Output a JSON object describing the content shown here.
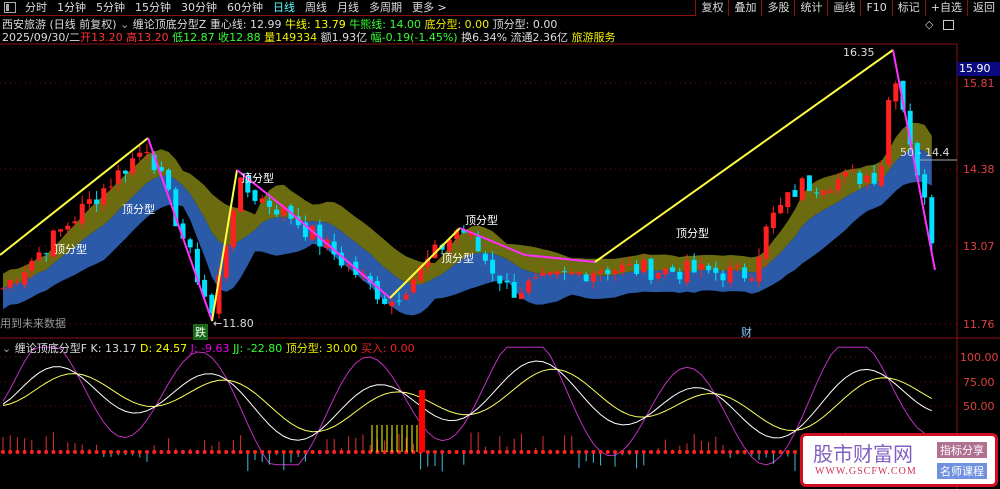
{
  "toolbar": {
    "periods": [
      "分时",
      "1分钟",
      "5分钟",
      "15分钟",
      "30分钟",
      "60分钟",
      "日线",
      "周线",
      "月线",
      "多周期",
      "更多 >"
    ],
    "active": "日线",
    "buttons": [
      "复权",
      "叠加",
      "多股",
      "统计",
      "画线",
      "F10",
      "标记",
      "+自选",
      "返回"
    ]
  },
  "header": {
    "stock": "西安旅游 (日线 前复权)",
    "indicator": "缠论顶底分型Z",
    "center_line": "重心线: 12.99",
    "bull_line": "牛线: 13.79",
    "bullbear_line": "牛熊线: 14.00",
    "bottom_fractal": "底分型: 0.00",
    "top_fractal": "顶分型: 0.00"
  },
  "quote": {
    "date": "2025/09/30/二",
    "open": "开13.20",
    "high": "高13.20",
    "low": "低12.87",
    "close": "收12.88",
    "volume": "量149334",
    "amount": "额1.93亿",
    "change": "幅-0.19(-1.45%)",
    "turnover": "换6.34%",
    "float": "流通2.36亿",
    "sector": "旅游服务"
  },
  "price_axis": {
    "current": "15.90",
    "ticks": [
      "15.81",
      "14.38",
      "13.07",
      "11.76"
    ]
  },
  "annotations": {
    "fractal_label": "顶分型",
    "high": "16.35",
    "low": "←11.80",
    "drop": "跌",
    "cai": "财",
    "future_warning": "用到未来数据",
    "cursor_price": "50 - 14.4"
  },
  "indicator": {
    "name": "缠论顶底分型F",
    "k": "K: 13.17",
    "d": "D: 24.57",
    "j": "J: -9.63",
    "jj": "JJ: -22.80",
    "top": "顶分型: 30.00",
    "buy": "买入: 0.00",
    "ticks": [
      "100.00",
      "75.00",
      "50.00"
    ]
  },
  "ad": {
    "title": "股市财富网",
    "url": "WWW.GSCFW.COM",
    "tag1": "指标分享",
    "tag2": "名师课程"
  },
  "colors": {
    "up": "#ff2020",
    "down": "#00e0ff",
    "zig_up": "#ffff40",
    "zig_down": "#ff30ff",
    "cloud_up": "#6b6b10",
    "cloud_down": "#2a5aa8"
  }
}
